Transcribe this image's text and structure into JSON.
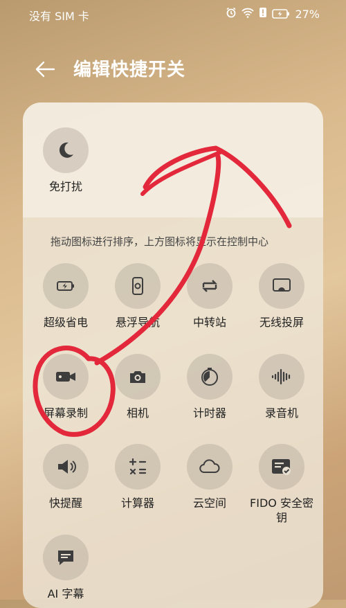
{
  "status_bar": {
    "carrier": "没有 SIM 卡",
    "battery": "27%"
  },
  "header": {
    "title": "编辑快捷开关"
  },
  "hint": "拖动图标进行排序，上方图标将显示在控制中心",
  "active_tiles": [
    {
      "label": "免打扰",
      "icon": "moon-icon"
    }
  ],
  "tiles": [
    {
      "label": "超级省电",
      "icon": "battery-saver-icon"
    },
    {
      "label": "悬浮导航",
      "icon": "floating-nav-icon"
    },
    {
      "label": "中转站",
      "icon": "transfer-station-icon"
    },
    {
      "label": "无线投屏",
      "icon": "wireless-projection-icon"
    },
    {
      "label": "屏幕录制",
      "icon": "screen-record-icon"
    },
    {
      "label": "相机",
      "icon": "camera-icon"
    },
    {
      "label": "计时器",
      "icon": "timer-icon"
    },
    {
      "label": "录音机",
      "icon": "recorder-icon"
    },
    {
      "label": "快提醒",
      "icon": "quick-reminder-icon"
    },
    {
      "label": "计算器",
      "icon": "calculator-icon"
    },
    {
      "label": "云空间",
      "icon": "cloud-icon"
    },
    {
      "label": "FIDO 安全密钥",
      "icon": "fido-key-icon"
    },
    {
      "label": "AI 字幕",
      "icon": "ai-subtitle-icon"
    }
  ],
  "colors": {
    "annotation": "#e3283c",
    "icon": "#3d3d3d"
  }
}
